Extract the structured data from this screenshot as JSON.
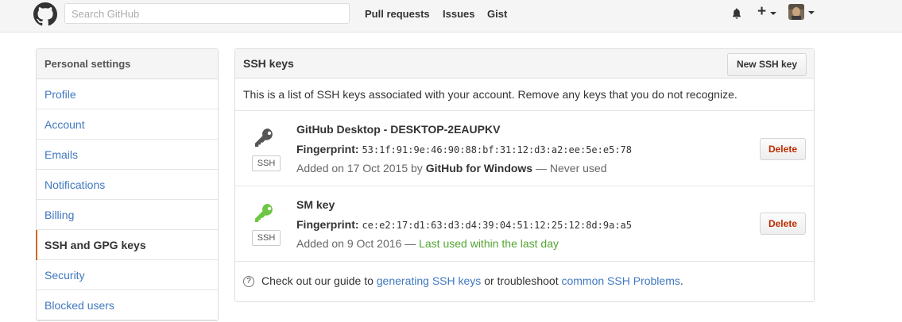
{
  "header": {
    "search_placeholder": "Search GitHub",
    "nav": [
      "Pull requests",
      "Issues",
      "Gist"
    ]
  },
  "sidebar": {
    "heading": "Personal settings",
    "items": [
      {
        "label": "Profile"
      },
      {
        "label": "Account"
      },
      {
        "label": "Emails"
      },
      {
        "label": "Notifications"
      },
      {
        "label": "Billing"
      },
      {
        "label": "SSH and GPG keys",
        "selected": true
      },
      {
        "label": "Security"
      },
      {
        "label": "Blocked users"
      }
    ]
  },
  "panel": {
    "title": "SSH keys",
    "new_button": "New SSH key",
    "description": "This is a list of SSH keys associated with your account. Remove any keys that you do not recognize.",
    "keys": [
      {
        "title": "GitHub Desktop - DESKTOP-2EAUPKV",
        "fingerprint_label": "Fingerprint:",
        "fingerprint": "53:1f:91:9e:46:90:88:bf:31:12:d3:a2:ee:5e:e5:78",
        "added_prefix": "Added on 17 Oct 2015 by",
        "added_by": "GitHub for Windows",
        "usage": "— Never used",
        "badge": "SSH",
        "delete": "Delete",
        "icon_color": "#555555"
      },
      {
        "title": "SM key",
        "fingerprint_label": "Fingerprint:",
        "fingerprint": "ce:e2:17:d1:63:d3:d4:39:04:51:12:25:12:8d:9a:a5",
        "added_prefix": "Added on 9 Oct 2016 —",
        "usage": "Last used within the last day",
        "badge": "SSH",
        "delete": "Delete",
        "icon_color": "#6cc644"
      }
    ],
    "footer": {
      "text1": "Check out our guide to",
      "link1": "generating SSH keys",
      "text2": "or troubleshoot",
      "link2": "common SSH Problems",
      "text3": "."
    }
  },
  "colors": {
    "link": "#4078c0",
    "selected_accent": "#d26911",
    "danger": "#bd2c00",
    "success": "#55a532"
  }
}
